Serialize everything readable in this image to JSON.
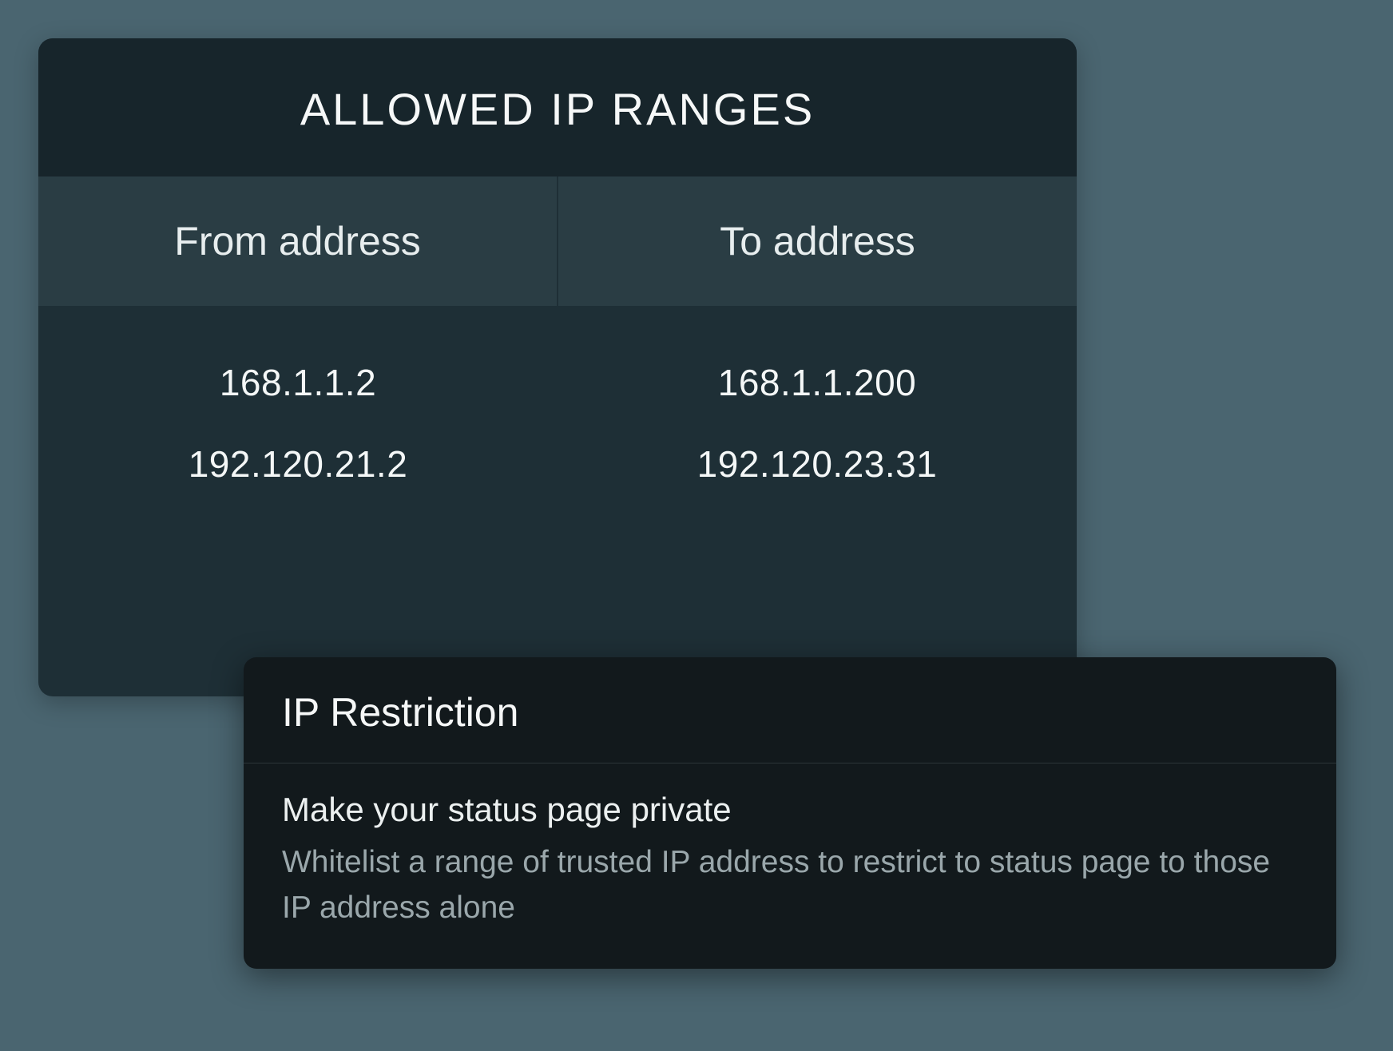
{
  "table": {
    "title": "ALLOWED IP RANGES",
    "columns": {
      "from": "From address",
      "to": "To address"
    },
    "rows": [
      {
        "from": "168.1.1.2",
        "to": "168.1.1.200"
      },
      {
        "from": "192.120.21.2",
        "to": "192.120.23.31"
      }
    ]
  },
  "info": {
    "title": "IP Restriction",
    "heading": "Make your status page private",
    "description": "Whitelist a range of trusted IP address to restrict to status page to those IP address alone"
  }
}
